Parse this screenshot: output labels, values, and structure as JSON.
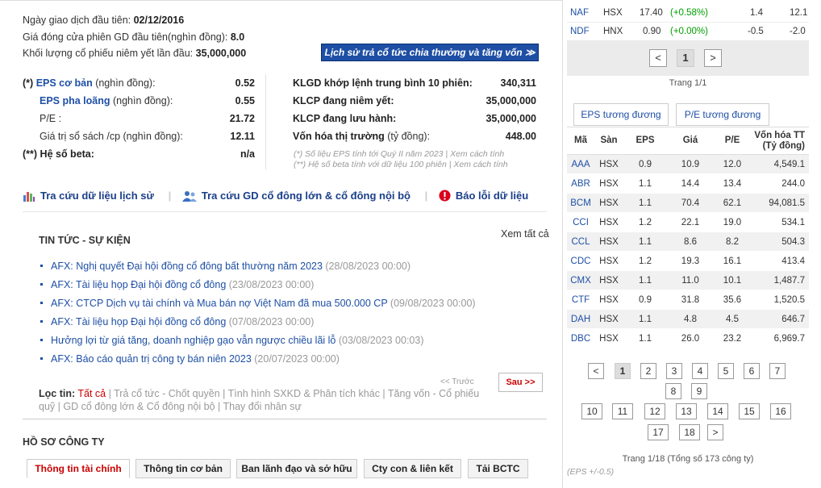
{
  "overview": {
    "first_trade_label": "Ngày giao dịch đầu tiên:",
    "first_trade_value": "02/12/2016",
    "first_close_label": "Giá đóng cửa phiên GD đầu tiên(nghìn đồng):",
    "first_close_value": "8.0",
    "first_volume_label": "Khối lượng cổ phiếu niêm yết lần đầu:",
    "first_volume_value": "35,000,000",
    "dividend_button": "Lịch sử trả cổ tức chia thưởng và tăng vốn ≫"
  },
  "metrics_left": [
    {
      "prefix": "(*)",
      "label": "EPS cơ bản",
      "unit": " (nghìn đồng):",
      "value": "0.52"
    },
    {
      "prefix": "",
      "label": "EPS pha loãng",
      "unit": " (nghìn đồng):",
      "value": "0.55"
    },
    {
      "prefix": "",
      "label": "P/E :",
      "unit": "",
      "value": "21.72"
    },
    {
      "prefix": "",
      "label": "Giá trị sổ sách /cp",
      "unit": " (nghìn đồng):",
      "value": "12.11"
    },
    {
      "prefix": "(**)",
      "label": "Hệ số beta:",
      "unit": "",
      "value": "n/a"
    }
  ],
  "metrics_right": [
    {
      "label": "KLGD khớp lệnh trung bình 10 phiên:",
      "value": "340,311"
    },
    {
      "label": "KLCP đang niêm yết:",
      "value": "35,000,000"
    },
    {
      "label": "KLCP đang lưu hành:",
      "value": "35,000,000"
    },
    {
      "label": "Vốn hóa thị trường",
      "unit": " (tỷ đồng):",
      "value": "448.00"
    }
  ],
  "notes": {
    "eps_note": "(*) Số liệu EPS tính tới Quý II năm 2023 | Xem cách tính",
    "beta_note": "(**) Hệ số beta tính với dữ liệu 100 phiên | Xem cách tính"
  },
  "links": {
    "history": "Tra cứu dữ liệu lịch sử",
    "insider": "Tra cứu GD cổ đông lớn & cổ đông nội bộ",
    "report_error": "Báo lỗi dữ liệu"
  },
  "news": {
    "title": "TIN TỨC - SỰ KIỆN",
    "see_all": "Xem tất cả",
    "items": [
      {
        "title": "AFX: Nghị quyết Đại hội đồng cổ đông bất thường năm 2023",
        "date": " (28/08/2023 00:00)"
      },
      {
        "title": "AFX: Tài liệu họp Đại hội đồng cổ đông",
        "date": " (23/08/2023 00:00)"
      },
      {
        "title": "AFX: CTCP Dịch vụ tài chính và Mua bán nợ Việt Nam đã mua 500.000 CP",
        "date": " (09/08/2023 00:00)"
      },
      {
        "title": "AFX: Tài liệu họp Đại hội đồng cổ đông",
        "date": " (07/08/2023 00:00)"
      },
      {
        "title": "Hưởng lợi từ giá tăng, doanh nghiệp gạo vẫn ngược chiều lãi lỗ",
        "date": " (03/08/2023 00:03)"
      },
      {
        "title": "AFX: Báo cáo quản trị công ty bán niên 2023",
        "date": " (20/07/2023 00:00)"
      }
    ],
    "prev": "<< Trước",
    "next": "Sau >>",
    "filter_label": "Lọc tin:",
    "filter_active": "Tất cả",
    "filter_rest": " | Trả cổ tức - Chốt quyền | Tình hình SXKD & Phân tích khác | Tăng vốn - Cổ phiếu quỹ | GD cổ đông lớn & Cổ đông nội bộ | Thay đổi nhân sự"
  },
  "profile": {
    "title": "HỒ SƠ CÔNG TY",
    "tabs": [
      "Thông tin tài chính",
      "Thông tin cơ bản",
      "Ban lãnh đạo và sở hữu",
      "Cty con & liên kết",
      "Tải BCTC"
    ]
  },
  "watchlist": [
    {
      "code": "NAF",
      "exchange": "HSX",
      "price": "17.40",
      "change": "(+0.58%)",
      "c1": "1.4",
      "c2": "12.1"
    },
    {
      "code": "NDF",
      "exchange": "HNX",
      "price": "0.90",
      "change": "(+0.00%)",
      "c1": "-0.5",
      "c2": "-2.0"
    }
  ],
  "watch_pager": {
    "prev": "<",
    "current": "1",
    "next": ">",
    "text": "Trang 1/1"
  },
  "peer": {
    "tabs": [
      "EPS tương đương",
      "P/E tương đương"
    ],
    "headers": [
      "Mã",
      "Sàn",
      "EPS",
      "Giá",
      "P/E",
      "Vốn hóa TT (Tỷ đồng)"
    ],
    "rows": [
      [
        "AAA",
        "HSX",
        "0.9",
        "10.9",
        "12.0",
        "4,549.1"
      ],
      [
        "ABR",
        "HSX",
        "1.1",
        "14.4",
        "13.4",
        "244.0"
      ],
      [
        "BCM",
        "HSX",
        "1.1",
        "70.4",
        "62.1",
        "94,081.5"
      ],
      [
        "CCI",
        "HSX",
        "1.2",
        "22.1",
        "19.0",
        "534.1"
      ],
      [
        "CCL",
        "HSX",
        "1.1",
        "8.6",
        "8.2",
        "504.3"
      ],
      [
        "CDC",
        "HSX",
        "1.2",
        "19.3",
        "16.1",
        "413.4"
      ],
      [
        "CMX",
        "HSX",
        "1.1",
        "11.0",
        "10.1",
        "1,487.7"
      ],
      [
        "CTF",
        "HSX",
        "0.9",
        "31.8",
        "35.6",
        "1,520.5"
      ],
      [
        "DAH",
        "HSX",
        "1.1",
        "4.8",
        "4.5",
        "646.7"
      ],
      [
        "DBC",
        "HSX",
        "1.1",
        "26.0",
        "23.2",
        "6,969.7"
      ]
    ],
    "pages": [
      "<",
      "1",
      "2",
      "3",
      "4",
      "5",
      "6",
      "7",
      "8",
      "9",
      "10",
      "11",
      "12",
      "13",
      "14",
      "15",
      "16",
      "17",
      "18",
      ">"
    ],
    "page_text": "Trang 1/18 (Tổng số 173 công ty)",
    "eps_note": "(EPS +/-0.5)"
  },
  "colors": {
    "link": "#1e4fa5",
    "positive": "#00a000",
    "accent": "#c00000"
  }
}
